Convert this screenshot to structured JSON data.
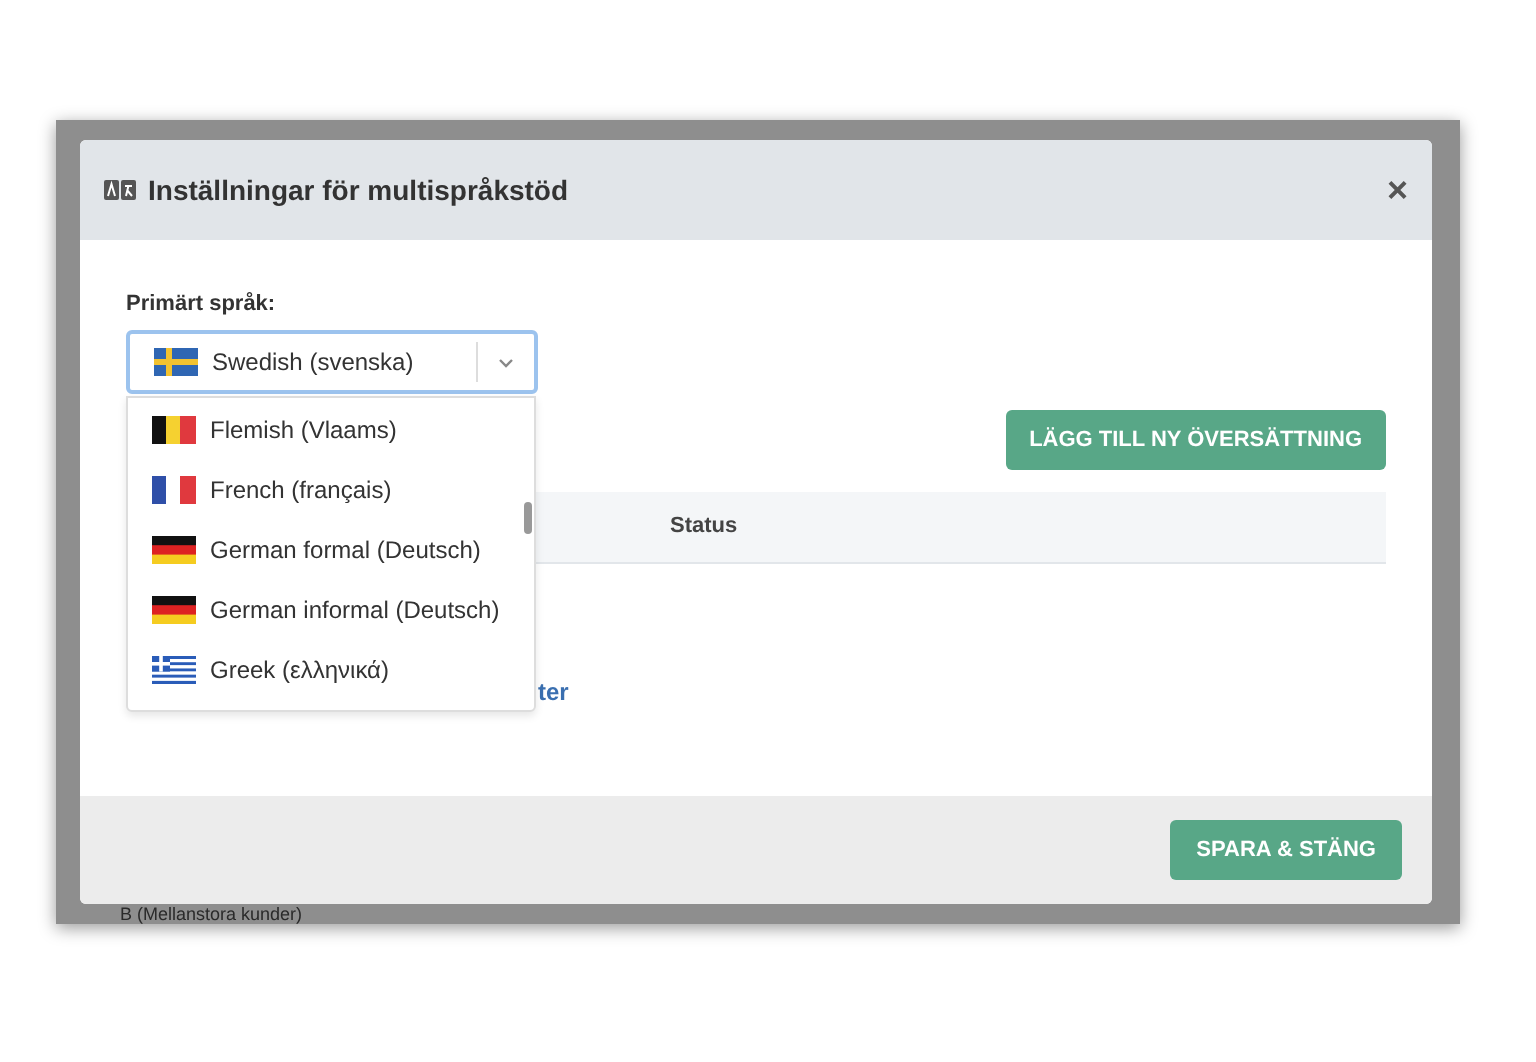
{
  "background": {
    "footer_text": "B (Mellanstora kunder)"
  },
  "dialog": {
    "title": "Inställningar för multispråkstöd",
    "close": "×"
  },
  "primary_language": {
    "label": "Primärt språk:",
    "value": "Swedish (svenska)",
    "kind": "se",
    "focused": true
  },
  "dropdown": {
    "options": [
      {
        "label": "Flemish (Vlaams)",
        "kind": "be"
      },
      {
        "label": "French (français)",
        "kind": "fr"
      },
      {
        "label": "German formal (Deutsch)",
        "kind": "de"
      },
      {
        "label": "German informal (Deutsch)",
        "kind": "de"
      },
      {
        "label": "Greek (ελληνικά)",
        "kind": "gr"
      }
    ]
  },
  "add_button": "LÄGG TILL NY ÖVERSÄTTNING",
  "table": {
    "columns": [
      "Status"
    ]
  },
  "link_fragment": "ter",
  "save_button": "SPARA & STÄNG"
}
